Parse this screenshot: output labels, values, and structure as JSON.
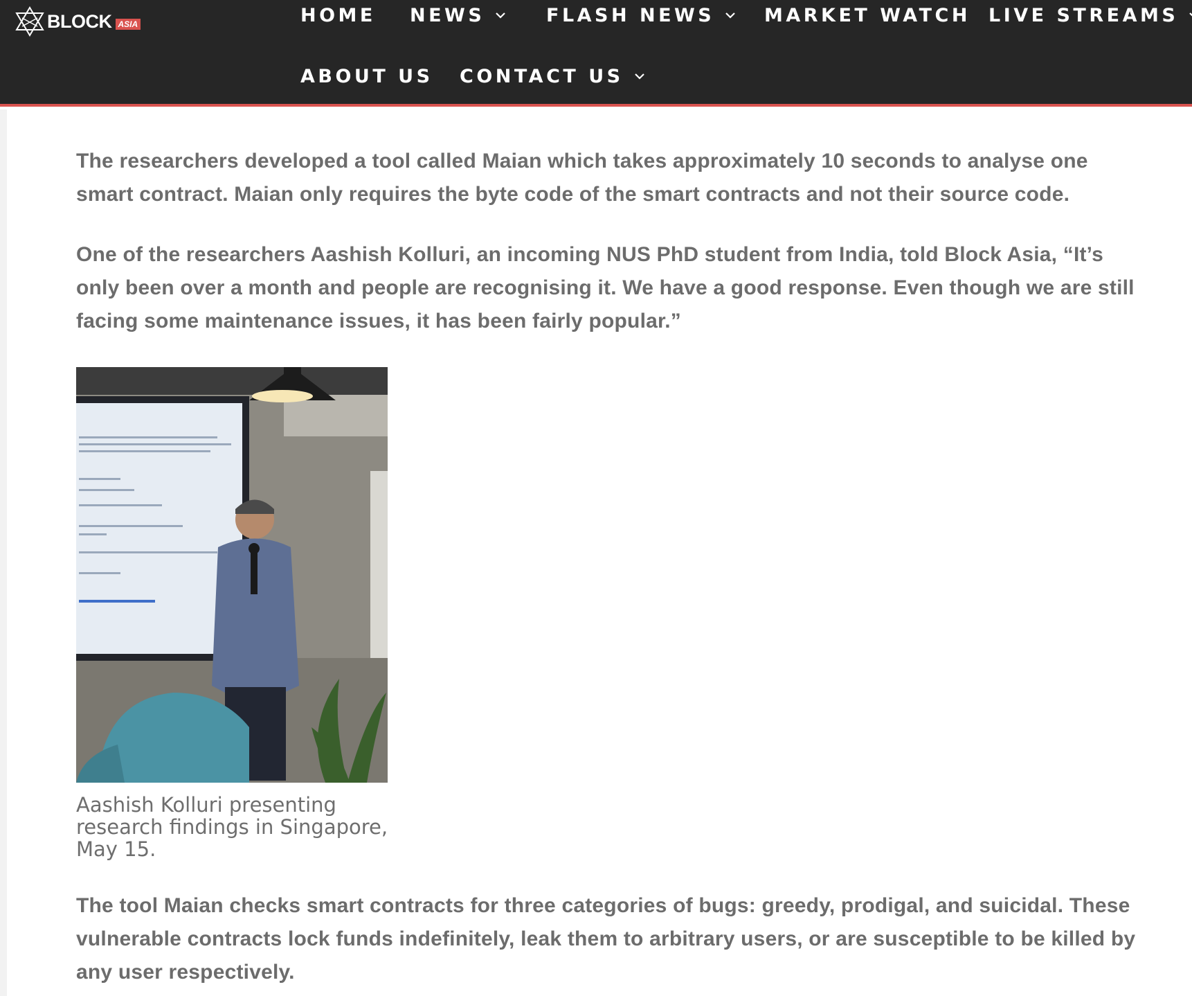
{
  "header": {
    "logo": {
      "text": "BLOCK",
      "badge": "ASIA"
    },
    "nav": [
      {
        "label": "HOME",
        "has_dropdown": false
      },
      {
        "label": "NEWS",
        "has_dropdown": true
      },
      {
        "label": "FLASH NEWS",
        "has_dropdown": true
      },
      {
        "label": "MARKET WATCH",
        "has_dropdown": false
      },
      {
        "label": "LIVE STREAMS",
        "has_dropdown": true
      },
      {
        "label": "ABOUT US",
        "has_dropdown": false
      },
      {
        "label": "CONTACT US",
        "has_dropdown": true
      }
    ],
    "accent_color": "#d9534f",
    "background_color": "#262626"
  },
  "article": {
    "paragraphs": [
      "The researchers developed a tool called Maian which takes approximately 10 seconds to analyse one smart contract. Maian only requires the byte code of the smart contracts and not their source code.",
      "One of the researchers Aashish Kolluri, an incoming NUS PhD student from India, told Block Asia, “It’s only been over a month and people are recognising it. We have a good response. Even though we are still facing some maintenance issues, it has been fairly popular.”",
      "The tool Maian checks smart contracts for three categories of bugs: greedy, prodigal, and suicidal. These vulnerable contracts lock funds indefinitely, leak them to arbitrary users, or are susceptible to be killed by any user respectively."
    ],
    "figure": {
      "alt": "Aashish Kolluri presenting",
      "caption": "Aashish Kolluri presenting research findings in Singapore, May 15."
    }
  }
}
